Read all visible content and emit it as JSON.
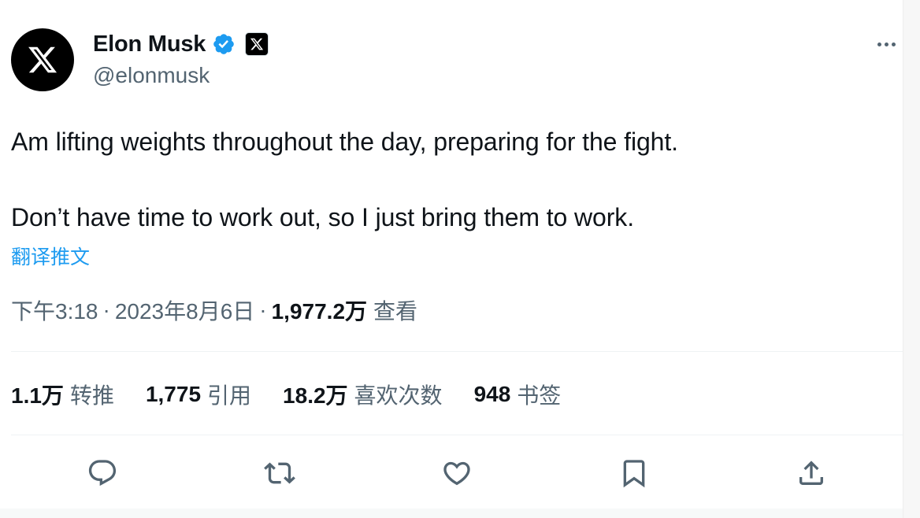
{
  "author": {
    "display_name": "Elon Musk",
    "handle": "@elonmusk",
    "verified": true,
    "affiliate_badge_icon": "x-logo-icon",
    "avatar_icon": "x-logo-icon"
  },
  "tweet": {
    "text_line_1": "Am lifting weights throughout the day, preparing for the fight.",
    "text_line_2": "Don’t have time to work out, so I just bring them to work.",
    "translate_label": "翻译推文"
  },
  "meta": {
    "time": "下午3:18",
    "separator": "·",
    "date": "2023年8月6日",
    "views_count": "1,977.2万",
    "views_label": "查看"
  },
  "stats": {
    "retweets_count": "1.1万",
    "retweets_label": "转推",
    "quotes_count": "1,775",
    "quotes_label": "引用",
    "likes_count": "18.2万",
    "likes_label": "喜欢次数",
    "bookmarks_count": "948",
    "bookmarks_label": "书签"
  },
  "actions": [
    "reply-icon",
    "retweet-icon",
    "like-icon",
    "bookmark-icon",
    "share-icon"
  ],
  "colors": {
    "accent": "#1d9bf0",
    "text_primary": "#0f1419",
    "text_secondary": "#536471",
    "divider": "#eff3f4"
  }
}
